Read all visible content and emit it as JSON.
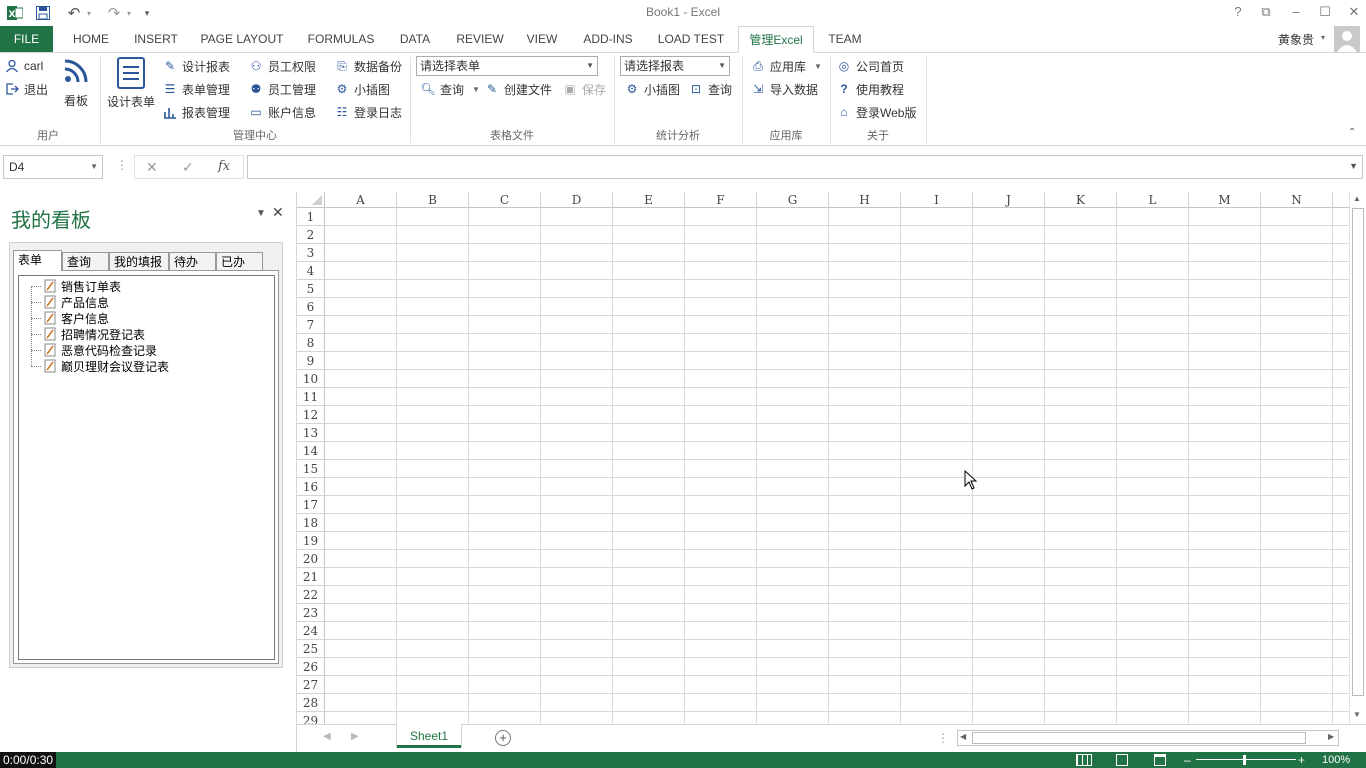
{
  "window": {
    "title": "Book1 - Excel",
    "help": "?",
    "restore_ribbon": "⧉",
    "minimize": "–",
    "maximize": "☐",
    "close": "✕"
  },
  "qat": {
    "undo": "↶",
    "redo": "↷",
    "more": "▾"
  },
  "tabs": [
    {
      "label": "FILE"
    },
    {
      "label": "HOME"
    },
    {
      "label": "INSERT"
    },
    {
      "label": "PAGE LAYOUT"
    },
    {
      "label": "FORMULAS"
    },
    {
      "label": "DATA"
    },
    {
      "label": "REVIEW"
    },
    {
      "label": "VIEW"
    },
    {
      "label": "ADD-INS"
    },
    {
      "label": "LOAD TEST"
    },
    {
      "label": "管理Excel"
    },
    {
      "label": "TEAM"
    }
  ],
  "user": {
    "name": "黄象贵"
  },
  "ribbon": {
    "user_group": {
      "label": "用户",
      "user": "carl",
      "logout": "退出",
      "board": "看板"
    },
    "mgmt_group": {
      "label": "管理中心",
      "design_form": "设计表单",
      "design_report": "设计报表",
      "form_manage": "表单管理",
      "report_manage": "报表管理",
      "emp_perm": "员工权限",
      "emp_manage": "员工管理",
      "account_info": "账户信息",
      "data_backup": "数据备份",
      "small_chart": "小插图",
      "login_log": "登录日志"
    },
    "file_group": {
      "label": "表格文件",
      "select_form": "请选择表单",
      "query": "查询",
      "create_file": "创建文件",
      "save": "保存"
    },
    "stats_group": {
      "label": "统计分析",
      "select_report": "请选择报表",
      "small_chart": "小插图",
      "query": "查询"
    },
    "app_group": {
      "label": "应用库",
      "app_lib": "应用库",
      "import_data": "导入数据"
    },
    "about_group": {
      "label": "关于",
      "homepage": "公司首页",
      "tutorial": "使用教程",
      "web_login": "登录Web版"
    }
  },
  "formula_bar": {
    "name_box": "D4",
    "cancel": "✕",
    "enter": "✓",
    "fx": "fx",
    "formula": ""
  },
  "task_pane": {
    "title": "我的看板",
    "tabs": [
      "表单",
      "查询",
      "我的填报",
      "待办",
      "已办"
    ],
    "items": [
      "销售订单表",
      "产品信息",
      "客户信息",
      "招聘情况登记表",
      "恶意代码检查记录",
      "巅贝理财会议登记表"
    ]
  },
  "grid": {
    "columns": [
      "A",
      "B",
      "C",
      "D",
      "E",
      "F",
      "G",
      "H",
      "I",
      "J",
      "K",
      "L",
      "M",
      "N"
    ],
    "rows": [
      "1",
      "2",
      "3",
      "4",
      "5",
      "6",
      "7",
      "8",
      "9",
      "10",
      "11",
      "12",
      "13",
      "14",
      "15",
      "16",
      "17",
      "18",
      "19",
      "20",
      "21",
      "22",
      "23",
      "24",
      "25",
      "26",
      "27",
      "28",
      "29"
    ]
  },
  "sheets": {
    "active": "Sheet1",
    "add": "+"
  },
  "status": {
    "timer": "0:00/0:30",
    "zoom": "100%"
  },
  "colors": {
    "accent": "#217346"
  }
}
